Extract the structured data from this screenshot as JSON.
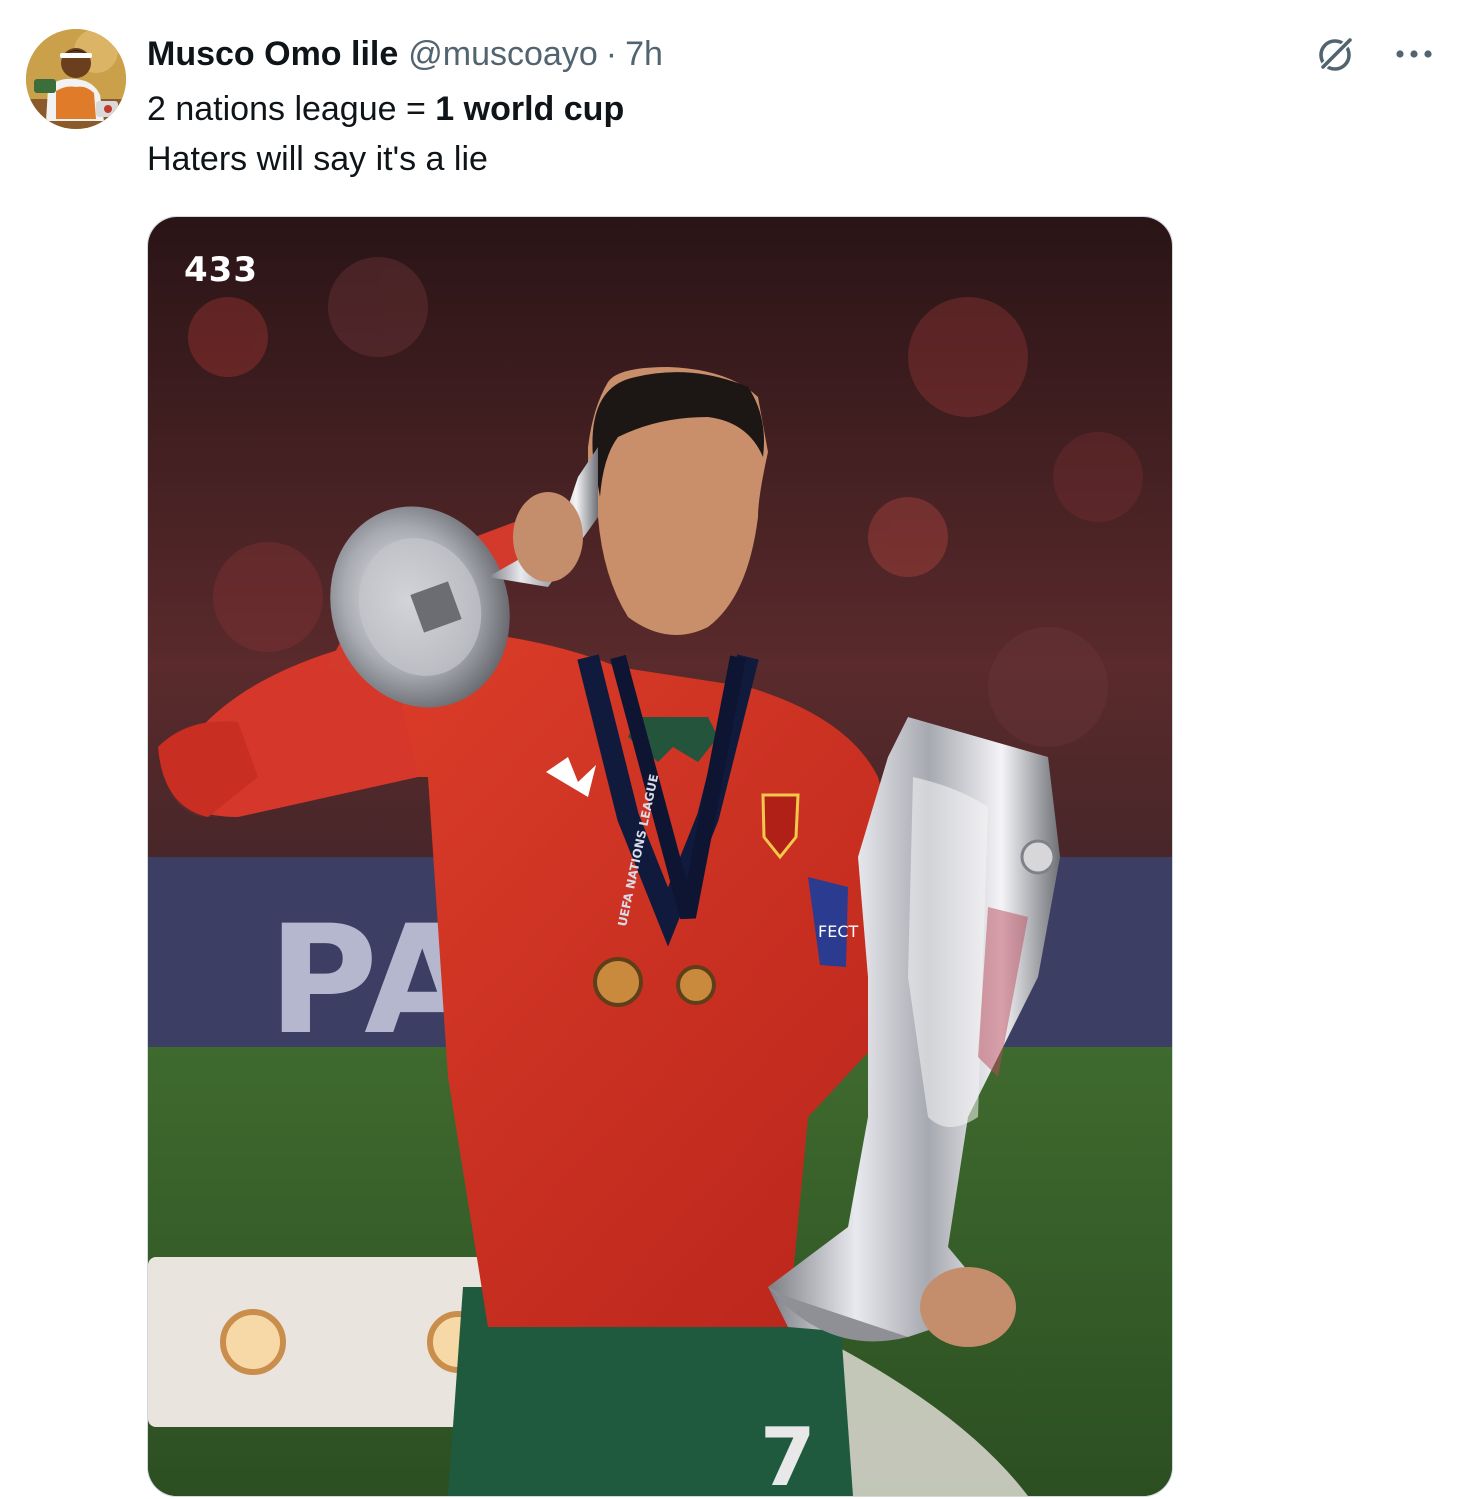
{
  "tweet": {
    "author": {
      "display_name": "Musco Omo lile",
      "handle": "@muscoayo"
    },
    "separator": "·",
    "time": "7h",
    "text": {
      "line1_plain": "2 nations league = ",
      "line1_bold": "1 world cup",
      "line2": "Haters will say it's a lie"
    },
    "actions": {
      "grok_icon": "grok-icon",
      "more_icon": "more-icon"
    },
    "media": {
      "watermark": "433",
      "board_text": "PARIS",
      "shirt_number": "7",
      "lanyard_text": "UEFA NATIONS LEAGUE",
      "armband_text": "FECT"
    }
  }
}
